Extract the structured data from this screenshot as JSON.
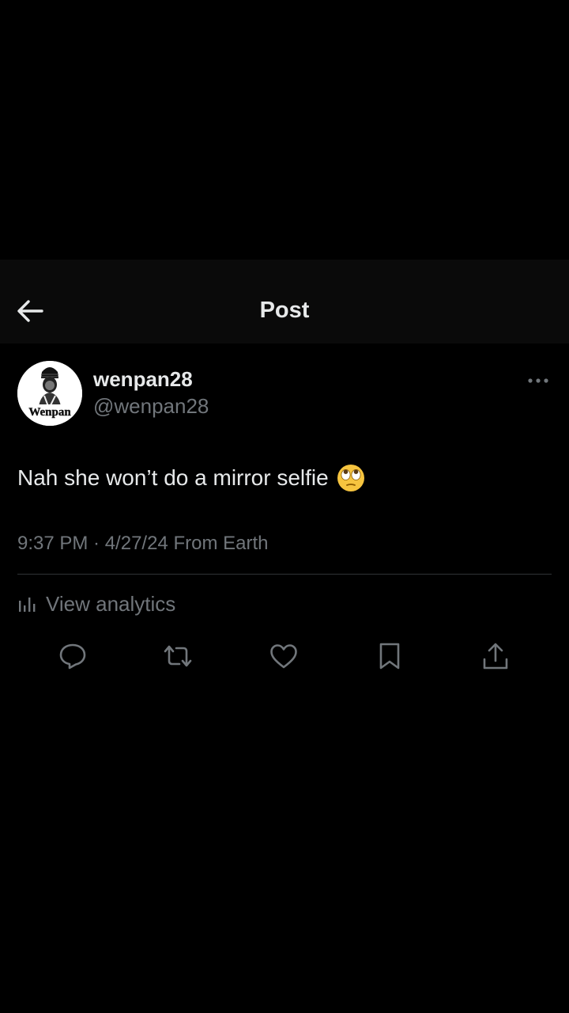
{
  "header": {
    "title": "Post",
    "back_icon": "arrow-left-icon"
  },
  "author": {
    "display_name": "wenpan28",
    "handle": "@wenpan28",
    "avatar_label": "Wenpan"
  },
  "post": {
    "text": "Nah she won’t do a mirror selfie",
    "emoji": "face-with-rolling-eyes",
    "timestamp": "9:37 PM · 4/27/24 From Earth"
  },
  "analytics": {
    "label": "View analytics",
    "icon": "bar-chart-icon"
  },
  "actions": [
    {
      "icon": "reply-icon"
    },
    {
      "icon": "repost-icon"
    },
    {
      "icon": "like-icon"
    },
    {
      "icon": "bookmark-icon"
    },
    {
      "icon": "share-icon"
    }
  ],
  "colors": {
    "background": "#000000",
    "header_bg": "#0a0a0a",
    "primary_text": "#e7e9ea",
    "secondary_text": "#71767b",
    "divider": "#2f3336"
  }
}
